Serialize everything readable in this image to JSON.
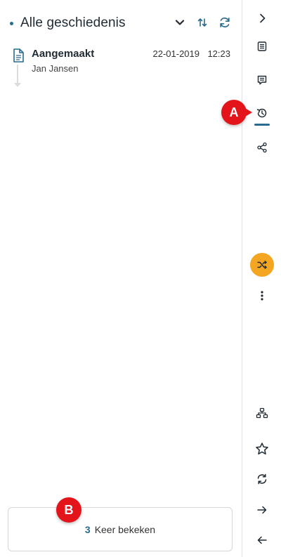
{
  "header": {
    "title": "Alle geschiedenis",
    "icons": [
      "chevron-down-icon",
      "sort-icon",
      "refresh-icon"
    ]
  },
  "history": [
    {
      "title": "Aangemaakt",
      "user": "Jan Jansen",
      "date": "22-01-2019",
      "time": "12:23",
      "icon": "document-icon"
    }
  ],
  "views": {
    "count": "3",
    "label": "Keer bekeken"
  },
  "markers": {
    "a": "A",
    "b": "B"
  },
  "rail": {
    "icons": [
      "chevron-right-icon",
      "document-list-icon",
      "comment-icon",
      "history-icon",
      "share-icon",
      "shuffle-icon",
      "more-vertical-icon",
      "hierarchy-icon",
      "star-icon",
      "sync-icon",
      "arrow-right-icon",
      "arrow-left-icon"
    ],
    "active": "history-icon"
  },
  "colors": {
    "accent": "#2a6b8f",
    "fab": "#f4a623",
    "marker": "#e4141b"
  }
}
